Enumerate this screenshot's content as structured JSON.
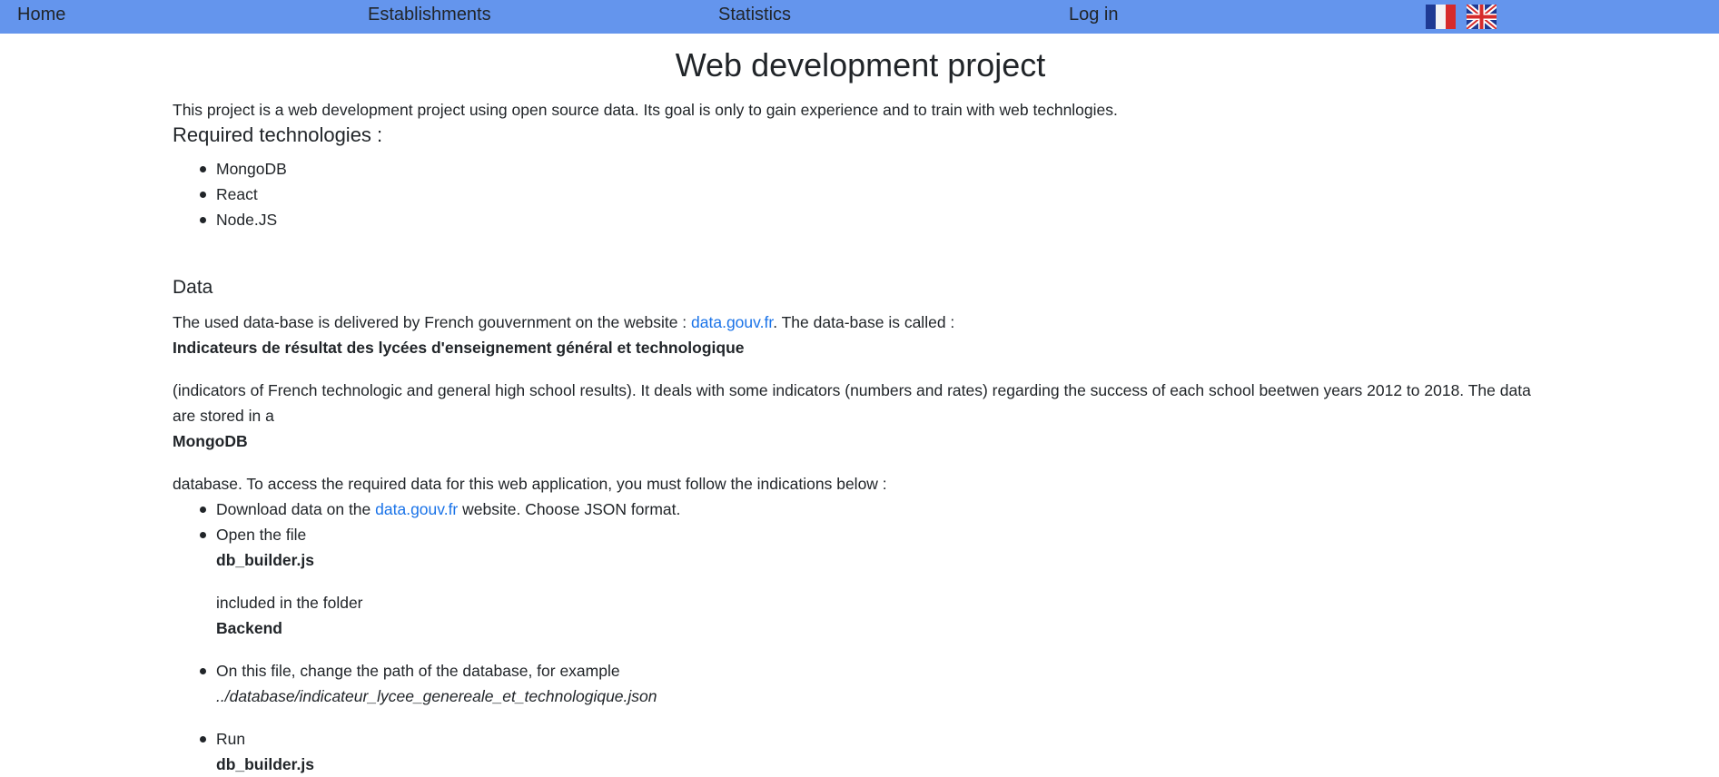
{
  "nav": {
    "home": "Home",
    "establishments": "Establishments",
    "statistics": "Statistics",
    "login": "Log in"
  },
  "title": "Web development project",
  "intro": "This project is a web development project using open source data. Its goal is only to gain experience and to train with web technlogies.",
  "required_heading": "Required technologies :",
  "technologies": [
    "MongoDB",
    "React",
    "Node.JS"
  ],
  "data_heading": "Data",
  "data_text_before": "The used data-base is delivered by French gouvernment on the website : ",
  "data_link": "data.gouv.fr",
  "data_text_after": ". The data-base is called :",
  "db_name": "Indicateurs de résultat des lycées d'enseignement général et technologique",
  "indicators_text": "(indicators of French technologic and general high school results). It deals with some indicators (numbers and rates) regarding the success of each school beetwen years 2012 to 2018. The data are stored in a",
  "mongodb_bold": "MongoDB",
  "database_text": "database. To access the required data for this web application, you must follow the indications below :",
  "steps": {
    "download_before": "Download data on the ",
    "download_link": "data.gouv.fr",
    "download_after": " website. Choose JSON format.",
    "open_file": "Open the file",
    "open_file_name": "db_builder.js",
    "included": "included in the folder",
    "folder": "Backend",
    "change_path": "On this file, change the path of the database, for example",
    "example_path": "../database/indicateur_lycee_genereale_et_technologique.json",
    "run": "Run",
    "run_file": "db_builder.js"
  },
  "flags": {
    "fr": "flag-fr-icon",
    "uk": "flag-uk-icon"
  },
  "colors": {
    "navbar": "#6495ed",
    "link": "#1a73e8"
  }
}
